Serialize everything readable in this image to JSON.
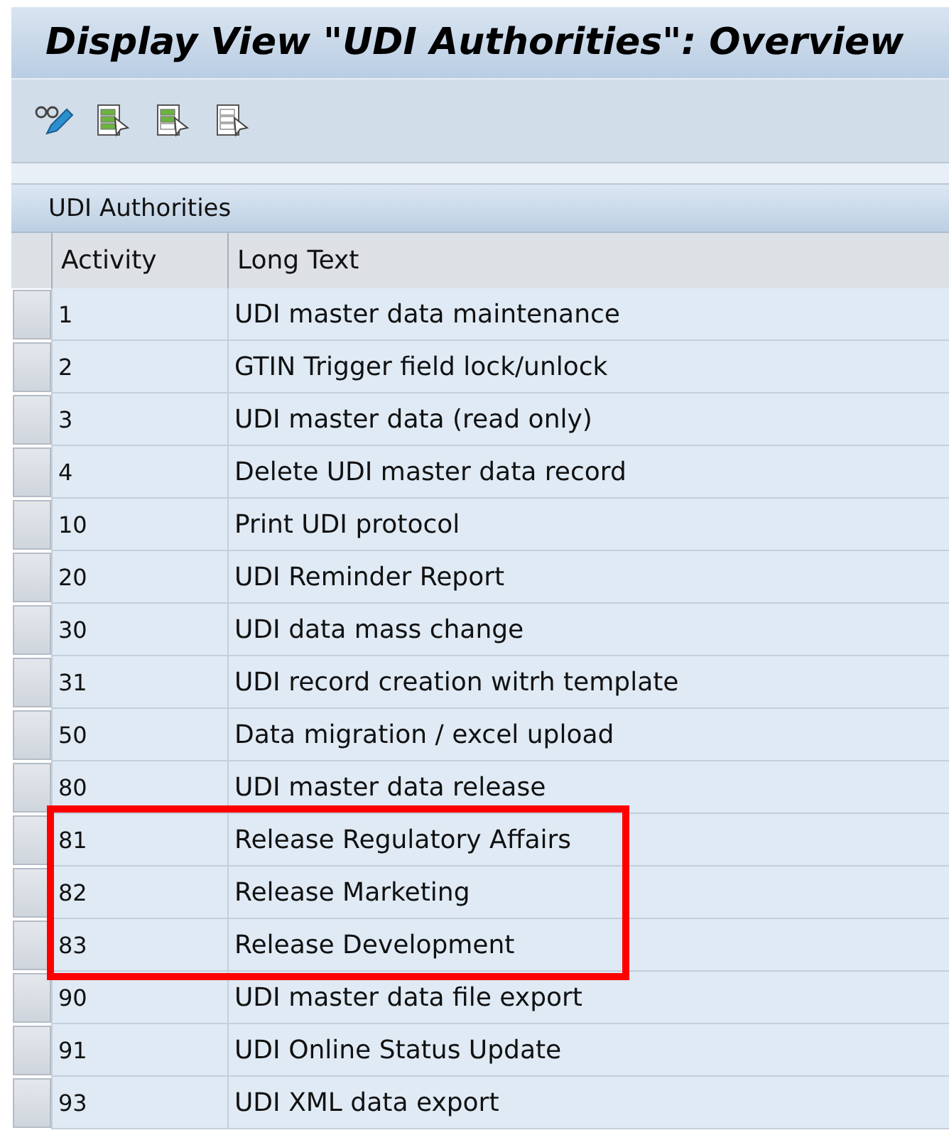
{
  "window": {
    "title": "Display View \"UDI Authorities\": Overview"
  },
  "toolbar": [
    {
      "kind": "display-change"
    },
    {
      "kind": "select-all"
    },
    {
      "kind": "select-block"
    },
    {
      "kind": "deselect-all"
    }
  ],
  "table": {
    "title": "UDI Authorities",
    "columns": [
      "Activity",
      "Long Text"
    ],
    "rows": [
      {
        "activity": "1",
        "long_text": "UDI master data maintenance",
        "highlighted": false
      },
      {
        "activity": "2",
        "long_text": "GTIN Trigger field lock/unlock",
        "highlighted": false
      },
      {
        "activity": "3",
        "long_text": "UDI master data (read only)",
        "highlighted": false
      },
      {
        "activity": "4",
        "long_text": "Delete UDI master data record",
        "highlighted": false
      },
      {
        "activity": "10",
        "long_text": "Print UDI protocol",
        "highlighted": false
      },
      {
        "activity": "20",
        "long_text": "UDI Reminder Report",
        "highlighted": false
      },
      {
        "activity": "30",
        "long_text": "UDI data mass change",
        "highlighted": false
      },
      {
        "activity": "31",
        "long_text": "UDI record creation witrh template",
        "highlighted": false
      },
      {
        "activity": "50",
        "long_text": "Data migration / excel upload",
        "highlighted": false
      },
      {
        "activity": "80",
        "long_text": "UDI master data release",
        "highlighted": false
      },
      {
        "activity": "81",
        "long_text": "Release Regulatory Affairs",
        "highlighted": true
      },
      {
        "activity": "82",
        "long_text": "Release Marketing",
        "highlighted": true
      },
      {
        "activity": "83",
        "long_text": "Release Development",
        "highlighted": true
      },
      {
        "activity": "90",
        "long_text": "UDI master data file export",
        "highlighted": false
      },
      {
        "activity": "91",
        "long_text": "UDI Online Status Update",
        "highlighted": false
      },
      {
        "activity": "93",
        "long_text": "UDI XML data export",
        "highlighted": false
      }
    ]
  }
}
